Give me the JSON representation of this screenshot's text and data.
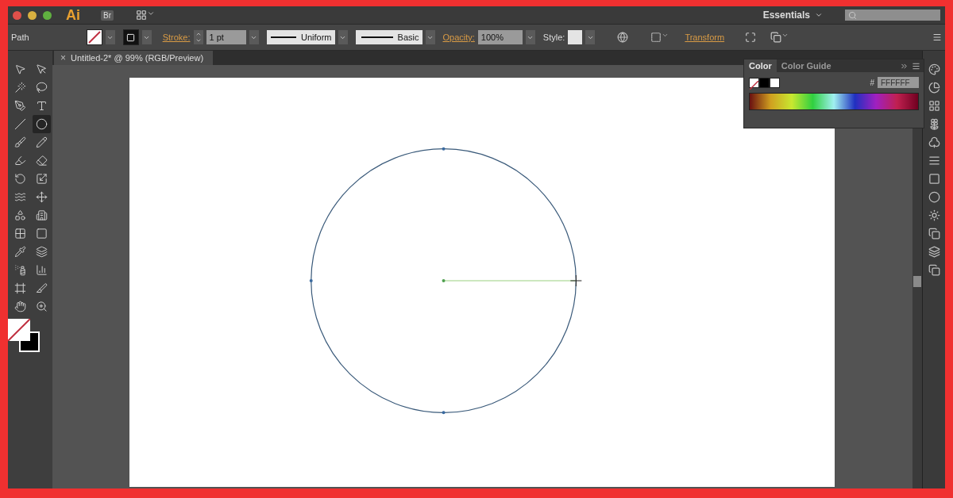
{
  "title_bar": {
    "logo": "Ai",
    "bridge": "Br",
    "workspace": "Essentials"
  },
  "control_bar": {
    "selection": "Path",
    "stroke_label": "Stroke:",
    "stroke_weight": "1 pt",
    "profile": "Uniform",
    "brush": "Basic",
    "opacity_label": "Opacity:",
    "opacity": "100%",
    "style_label": "Style:",
    "transform": "Transform"
  },
  "tools": [
    {
      "kind": "selection",
      "selected": false
    },
    {
      "kind": "direct",
      "selected": false
    },
    {
      "kind": "wand",
      "selected": false
    },
    {
      "kind": "lasso",
      "selected": false
    },
    {
      "kind": "pen",
      "selected": false
    },
    {
      "kind": "type",
      "selected": false
    },
    {
      "kind": "line",
      "selected": false
    },
    {
      "kind": "ellipse",
      "selected": true
    },
    {
      "kind": "brush",
      "selected": false
    },
    {
      "kind": "pencil",
      "selected": false
    },
    {
      "kind": "blob",
      "selected": false
    },
    {
      "kind": "eraser",
      "selected": false
    },
    {
      "kind": "rotate",
      "selected": false
    },
    {
      "kind": "scale",
      "selected": false
    },
    {
      "kind": "warp",
      "selected": false
    },
    {
      "kind": "transform",
      "selected": false
    },
    {
      "kind": "shapes",
      "selected": false
    },
    {
      "kind": "perspective",
      "selected": false
    },
    {
      "kind": "mesh",
      "selected": false
    },
    {
      "kind": "gradient",
      "selected": false
    },
    {
      "kind": "eyedropper",
      "selected": false
    },
    {
      "kind": "blend",
      "selected": false
    },
    {
      "kind": "symbol",
      "selected": false
    },
    {
      "kind": "graph",
      "selected": false
    },
    {
      "kind": "artboard",
      "selected": false
    },
    {
      "kind": "slice",
      "selected": false
    },
    {
      "kind": "hand",
      "selected": false
    },
    {
      "kind": "zoom",
      "selected": false
    }
  ],
  "document_tab": {
    "close": "×",
    "title": "Untitled-2* @ 99% (RGB/Preview)"
  },
  "color_panel": {
    "tabs": [
      {
        "label": "Color",
        "selected": true
      },
      {
        "label": "Color Guide",
        "selected": false
      }
    ],
    "hex_label": "#",
    "hex": "FFFFFF"
  }
}
